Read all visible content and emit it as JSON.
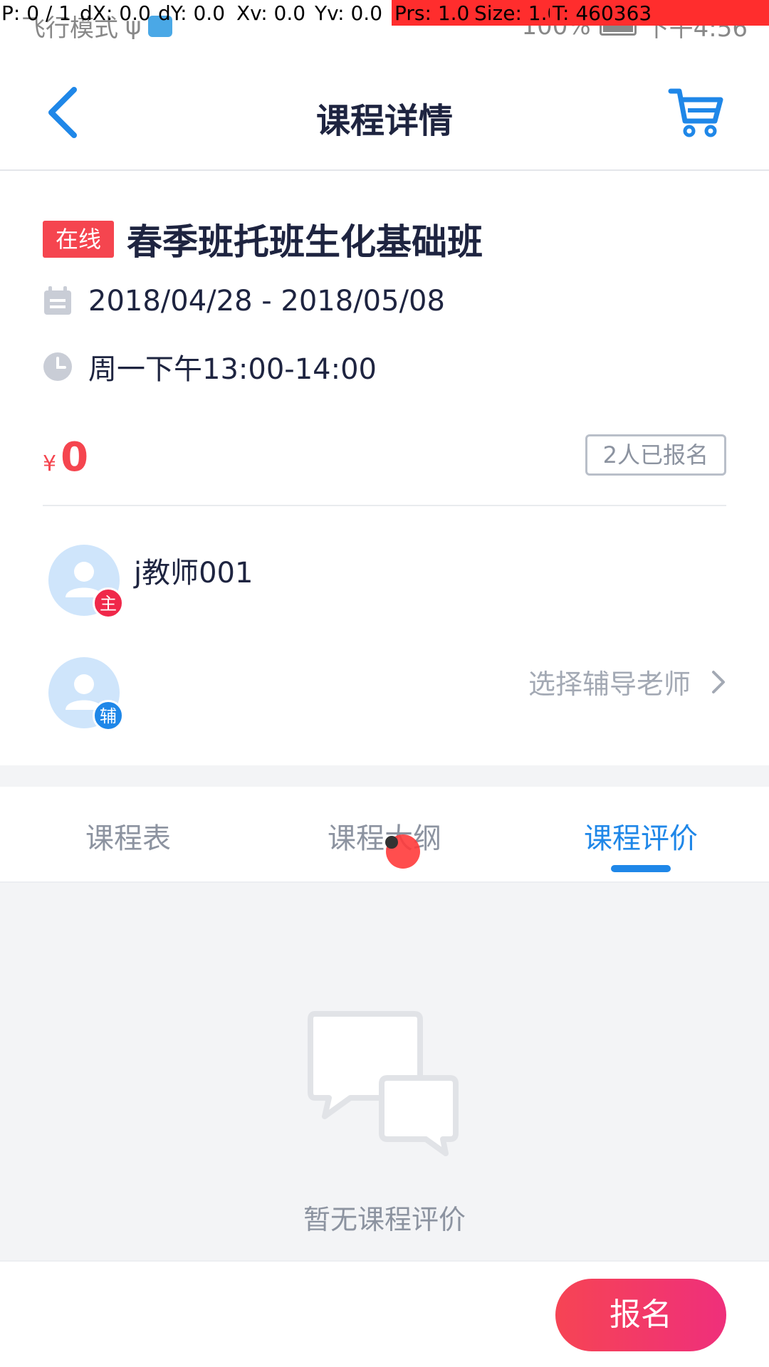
{
  "status_bar": {
    "left_text": "飞行模式",
    "battery": "100%",
    "time": "下午4:56"
  },
  "debug_overlay": {
    "p": "P: 0 / 1",
    "dx": "dX: 0.0",
    "dy": "dY: 0.0",
    "xv": "Xv: 0.0",
    "yv": "Yv: 0.0",
    "prs": "Prs: 1.0",
    "size": "Size: 1.0",
    "t": "T: 460363"
  },
  "header": {
    "title": "课程详情"
  },
  "course": {
    "badge": "在线",
    "title": "春季班托班生化基础班",
    "date_range": "2018/04/28 - 2018/05/08",
    "schedule": "周一下午13:00-14:00",
    "price_symbol": "¥",
    "price": "0",
    "enrolled": "2人已报名"
  },
  "teachers": {
    "main_badge": "主",
    "main_name": "j教师001",
    "tutor_badge": "辅",
    "select_tutor": "选择辅导老师"
  },
  "tabs": [
    {
      "label": "课程表",
      "active": false
    },
    {
      "label": "课程大纲",
      "active": false
    },
    {
      "label": "课程评价",
      "active": true
    }
  ],
  "empty_state": {
    "text": "暂无课程评价"
  },
  "bottom": {
    "enroll_label": "报名"
  },
  "colors": {
    "accent": "#1f87e8",
    "danger": "#f5454f",
    "main_badge": "#f0284a",
    "tutor_badge": "#1f87e8"
  }
}
